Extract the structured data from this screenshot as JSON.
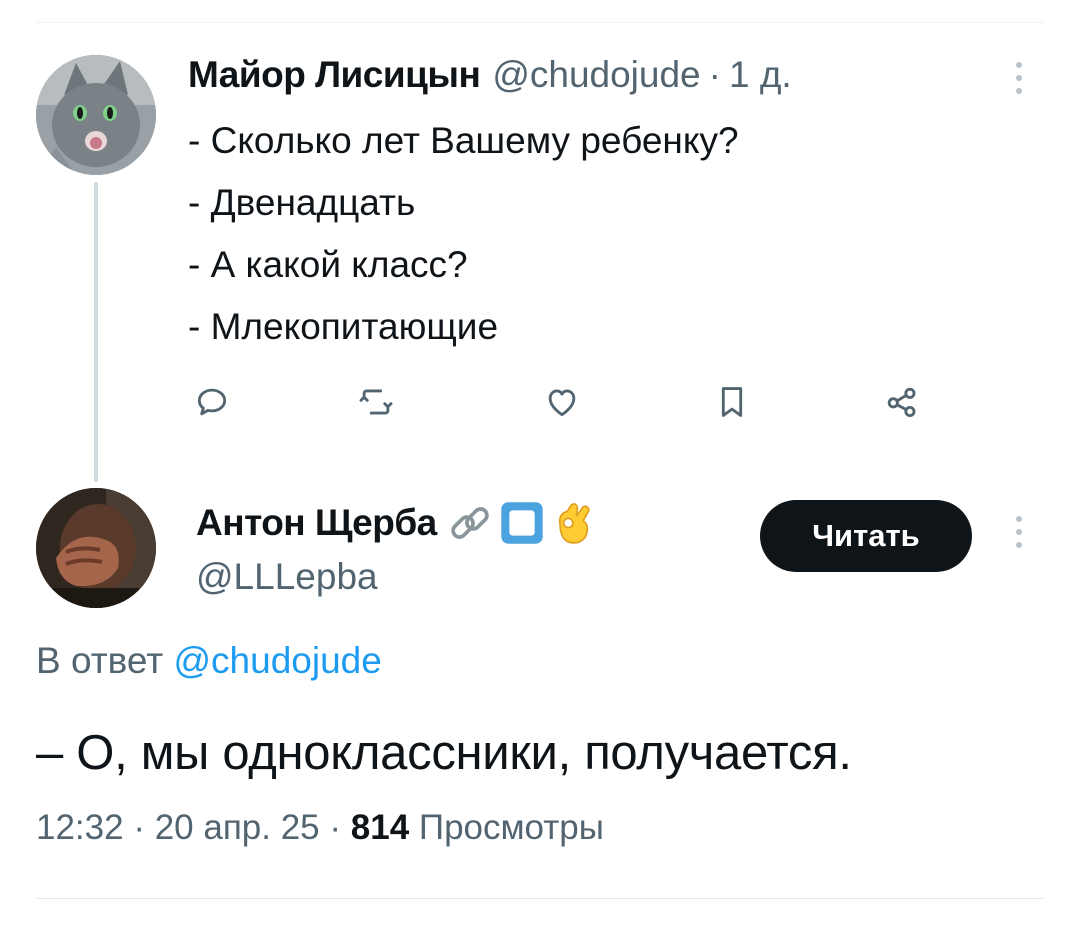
{
  "original_tweet": {
    "author_name": "Майор Лисицын",
    "handle": "@chudojude",
    "separator": "·",
    "age": "1 д.",
    "avatar_icon": "gray-cat-avatar",
    "lines": [
      "- Сколько лет Вашему ребенку?",
      "- Двенадцать",
      "- А какой класс?",
      "- Млекопитающие"
    ],
    "actions": [
      {
        "name": "reply",
        "icon": "reply-icon"
      },
      {
        "name": "retweet",
        "icon": "retweet-icon"
      },
      {
        "name": "like",
        "icon": "heart-icon"
      },
      {
        "name": "bookmark",
        "icon": "bookmark-icon"
      },
      {
        "name": "share",
        "icon": "share-icon"
      }
    ]
  },
  "reply_tweet": {
    "author_name": "Антон Щерба",
    "name_emojis": [
      "link-emoji",
      "stop-button-emoji",
      "ok-hand-emoji"
    ],
    "handle": "@LLLepba",
    "avatar_icon": "dark-photo-avatar",
    "follow_label": "Читать",
    "reply_prefix": "В ответ",
    "reply_to_handle": "@chudojude",
    "text": "– О, мы одноклассники, получается.",
    "meta": {
      "time": "12:32",
      "separator": "·",
      "date": "20 апр. 25",
      "views_count": "814",
      "views_label": "Просмотры"
    }
  },
  "colors": {
    "text_primary": "#0f1419",
    "text_secondary": "#536471",
    "link": "#1d9bf0",
    "button_bg": "#0f1419",
    "thread_line": "#cfd9de"
  }
}
